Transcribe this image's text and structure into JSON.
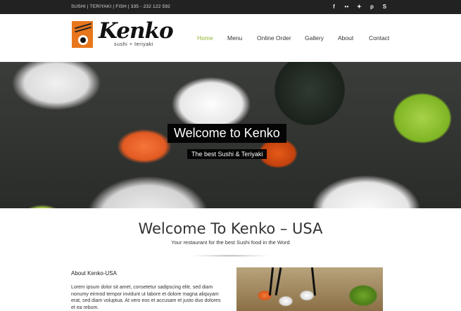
{
  "topbar": {
    "info": "SUSHI | TERIYAKI | FISH | 335 - 232 122 592",
    "social_icons": [
      "facebook-icon",
      "flickr-icon",
      "twitter-icon",
      "pinterest-icon",
      "skype-icon"
    ]
  },
  "brand": {
    "name": "Kenko",
    "subtitle": "sushi + teriyaki"
  },
  "nav": [
    {
      "label": "Home",
      "active": true
    },
    {
      "label": "Menu"
    },
    {
      "label": "Online Order"
    },
    {
      "label": "Gallery"
    },
    {
      "label": "About"
    },
    {
      "label": "Contact"
    }
  ],
  "hero": {
    "title": "Welcome to Kenko",
    "subtitle": "The best Sushi & Teriyaki"
  },
  "intro": {
    "heading": "Welcome To Kenko – USA",
    "tagline": "Your restaurant for the best Sushi food in the Word"
  },
  "about": {
    "heading": "About Kenko-USA",
    "text": "Lorem ipsum dolor sit amet, consetetur sadipscing elitr, sed diam nonumy eirmod tempor invidunt ut labore et dolore magna aliquyam erat, sed diam voluptua. At vero eos et accusam et justo duo dolores et ea rebum."
  },
  "colors": {
    "accent": "#8fb531",
    "topbar": "#222222",
    "logo_bg": "#e8761c"
  }
}
